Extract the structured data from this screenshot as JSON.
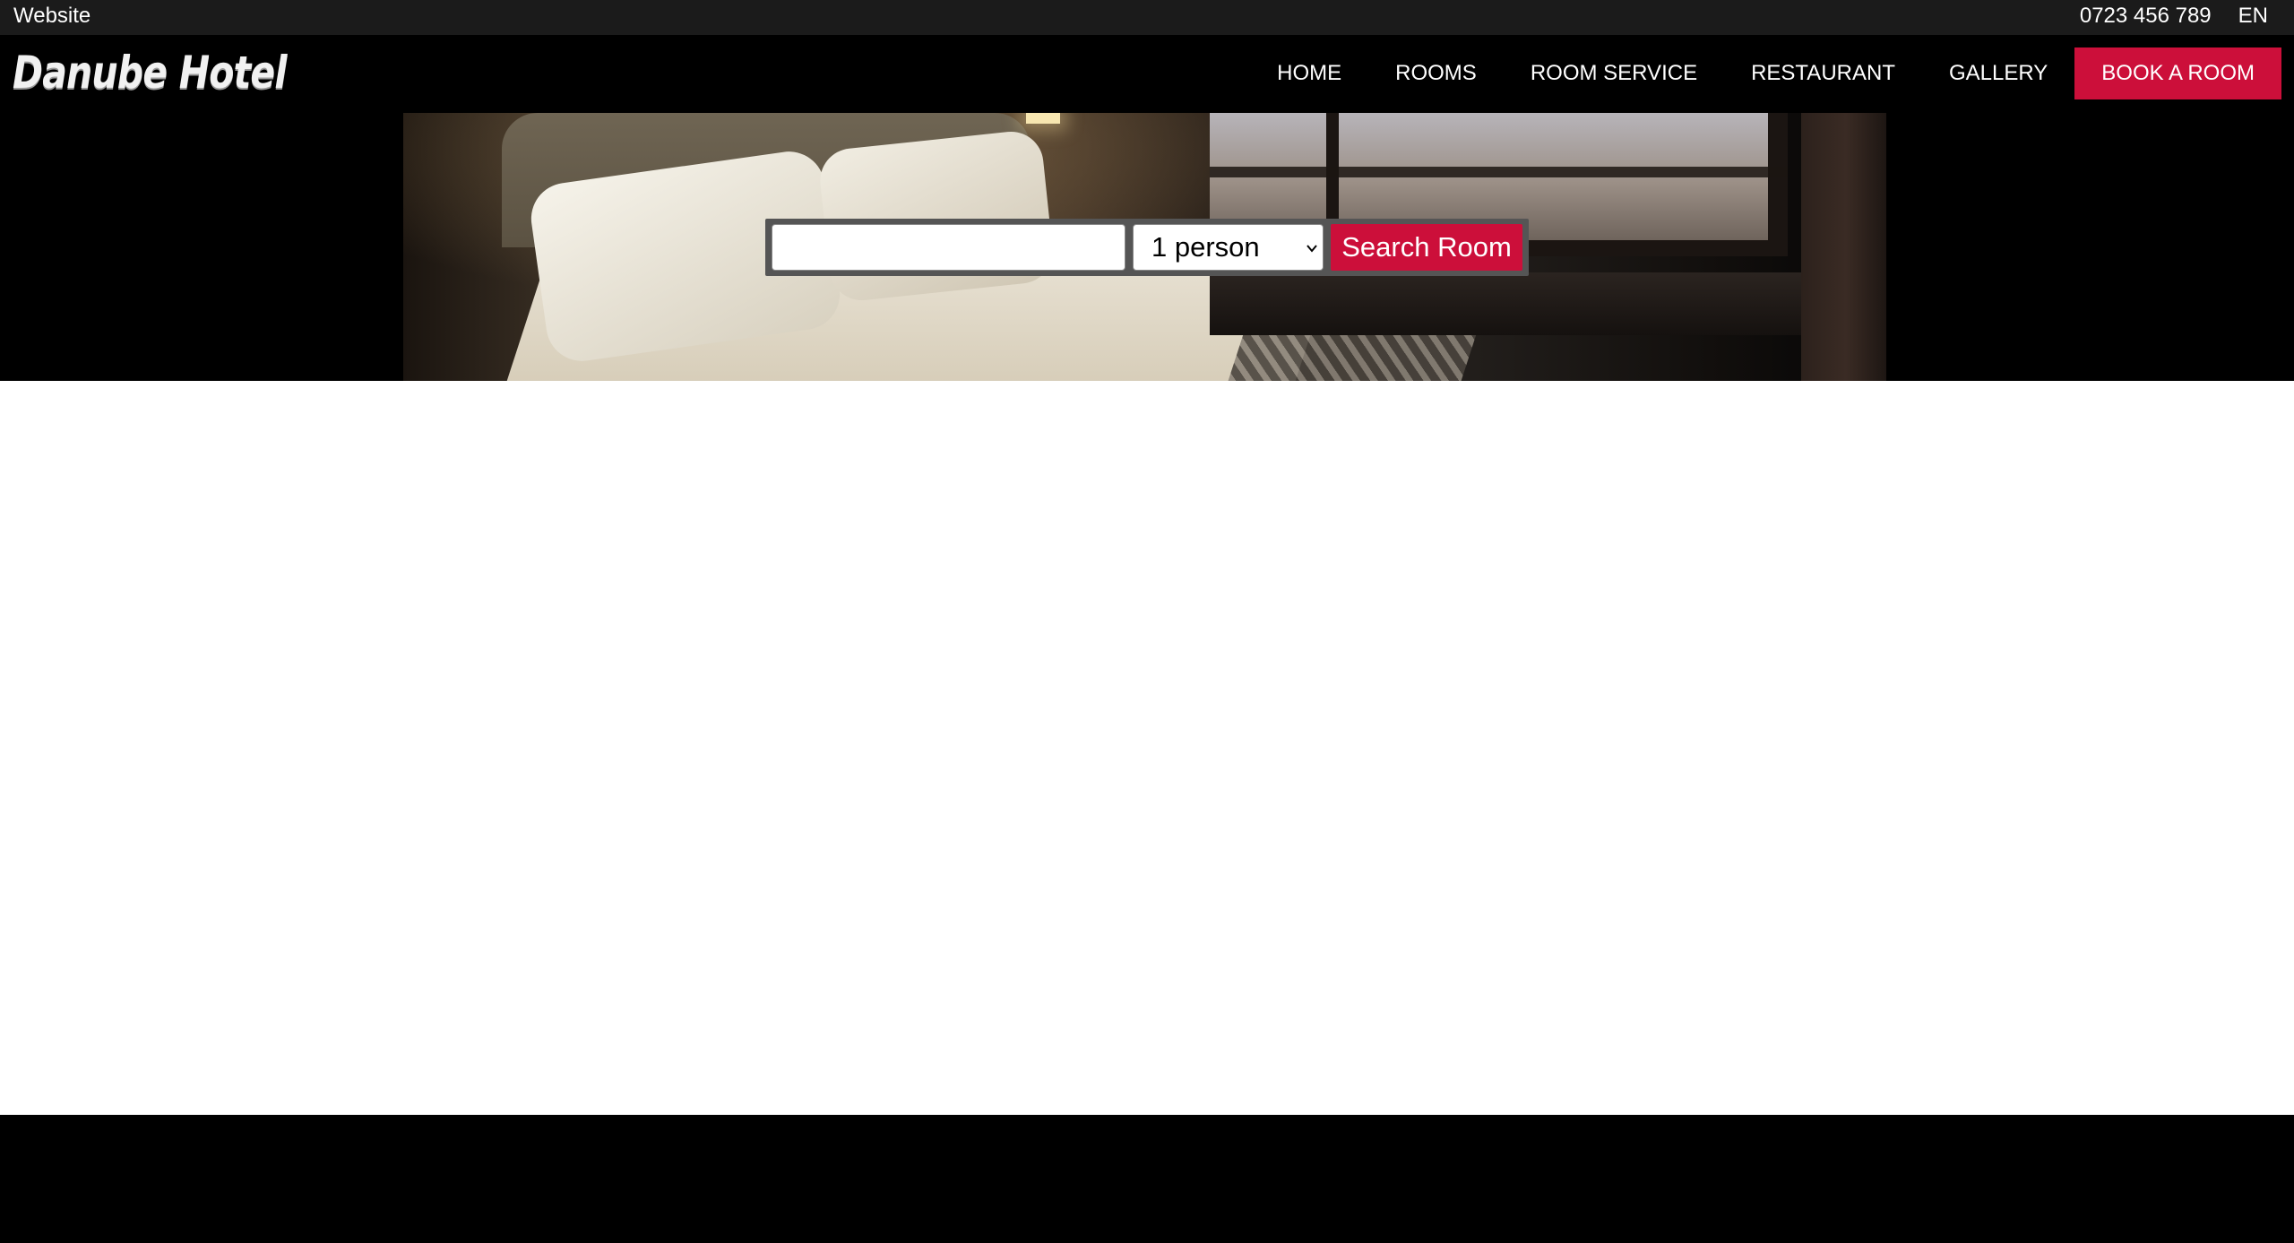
{
  "topbar": {
    "site_label": "Website",
    "phone": "0723 456 789",
    "language": "EN"
  },
  "header": {
    "logo_text": "Danube Hotel",
    "nav": [
      {
        "label": "HOME"
      },
      {
        "label": "ROOMS"
      },
      {
        "label": "ROOM SERVICE"
      },
      {
        "label": "RESTAURANT"
      },
      {
        "label": "GALLERY"
      }
    ],
    "book_label": "BOOK A ROOM"
  },
  "search": {
    "input_value": "",
    "persons_selected": "1 person",
    "button_label": "Search Room"
  },
  "colors": {
    "accent": "#cc0f3a",
    "topbar_bg": "#1b1b1b",
    "nav_bg": "#000000",
    "content_bg": "#ffffff",
    "footer_bg": "#000000"
  }
}
